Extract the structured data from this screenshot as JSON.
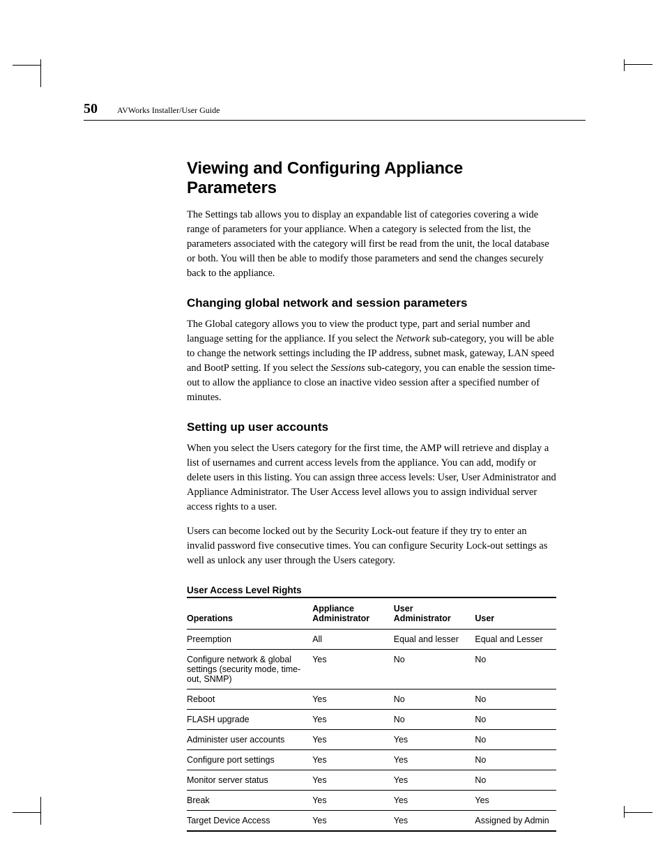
{
  "header": {
    "page_number": "50",
    "running_head": "AVWorks Installer/User Guide"
  },
  "h1": "Viewing and Configuring Appliance Parameters",
  "p1": "The Settings tab allows you to display an expandable list of categories covering a wide range of parameters for your appliance. When a category is selected from the list, the parameters associated with the category will first be read from the unit, the local database or both. You will then be able to modify those parameters and send the changes securely back to the appliance.",
  "h2a": "Changing global network and session parameters",
  "p2_a": "The Global category allows you to view the product type, part and serial number and language setting for the appliance. If you select the ",
  "p2_net": "Network",
  "p2_b": " sub-category, you will be able to change the network settings including the IP address, subnet mask, gateway, LAN speed and BootP setting. If you select the ",
  "p2_ses": "Sessions",
  "p2_c": " sub-category, you can enable the session time-out to allow the appliance to close an inactive video session after a specified number of minutes.",
  "h2b": "Setting up user accounts",
  "p3": "When you select the Users category for the first time, the AMP will retrieve and display a list of usernames and current access levels from the appliance. You can add, modify or delete users in this listing. You can assign three access levels: User, User Administrator and Appliance Administrator. The User Access level allows you to assign individual server access rights to a user.",
  "p4": "Users can become locked out by the Security Lock-out feature if they try to enter an invalid password five consecutive times. You can configure Security Lock-out settings as well as unlock any user through the Users category.",
  "table": {
    "title": "User Access Level Rights",
    "columns": [
      "Operations",
      "Appliance Administrator",
      "User Administrator",
      "User"
    ],
    "rows": [
      [
        "Preemption",
        "All",
        "Equal and lesser",
        "Equal and Lesser"
      ],
      [
        "Configure network & global settings (security mode, time-out, SNMP)",
        "Yes",
        "No",
        "No"
      ],
      [
        "Reboot",
        "Yes",
        "No",
        "No"
      ],
      [
        "FLASH upgrade",
        "Yes",
        "No",
        "No"
      ],
      [
        "Administer user accounts",
        "Yes",
        "Yes",
        "No"
      ],
      [
        "Configure port settings",
        "Yes",
        "Yes",
        "No"
      ],
      [
        "Monitor server status",
        "Yes",
        "Yes",
        "No"
      ],
      [
        "Break",
        "Yes",
        "Yes",
        "Yes"
      ],
      [
        "Target Device Access",
        "Yes",
        "Yes",
        "Assigned by Admin"
      ]
    ]
  }
}
